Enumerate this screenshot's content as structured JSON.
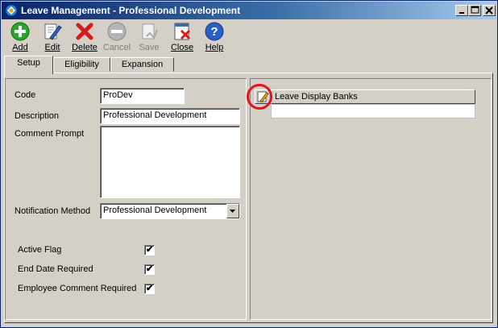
{
  "window": {
    "title": "Leave Management - Professional Development"
  },
  "toolbar": {
    "add": "Add",
    "edit": "Edit",
    "delete": "Delete",
    "cancel": "Cancel",
    "save": "Save",
    "close": "Close",
    "help": "Help"
  },
  "tabs": [
    "Setup",
    "Eligibility",
    "Expansion"
  ],
  "form": {
    "code_label": "Code",
    "code_value": "ProDev",
    "description_label": "Description",
    "description_value": "Professional Development",
    "comment_prompt_label": "Comment Prompt",
    "comment_prompt_value": "",
    "notification_label": "Notification Method",
    "notification_value": "Professional Development",
    "active_flag_label": "Active Flag",
    "active_flag_checked": true,
    "end_date_label": "End Date Required",
    "end_date_checked": true,
    "employee_comment_label": "Employee Comment Required",
    "employee_comment_checked": true
  },
  "grid": {
    "header": "Leave Display Banks",
    "rows": [
      ""
    ]
  },
  "colors": {
    "title_start": "#0a246a",
    "title_end": "#a6caf0",
    "highlight": "#e8121c",
    "face": "#d4d0c8"
  }
}
